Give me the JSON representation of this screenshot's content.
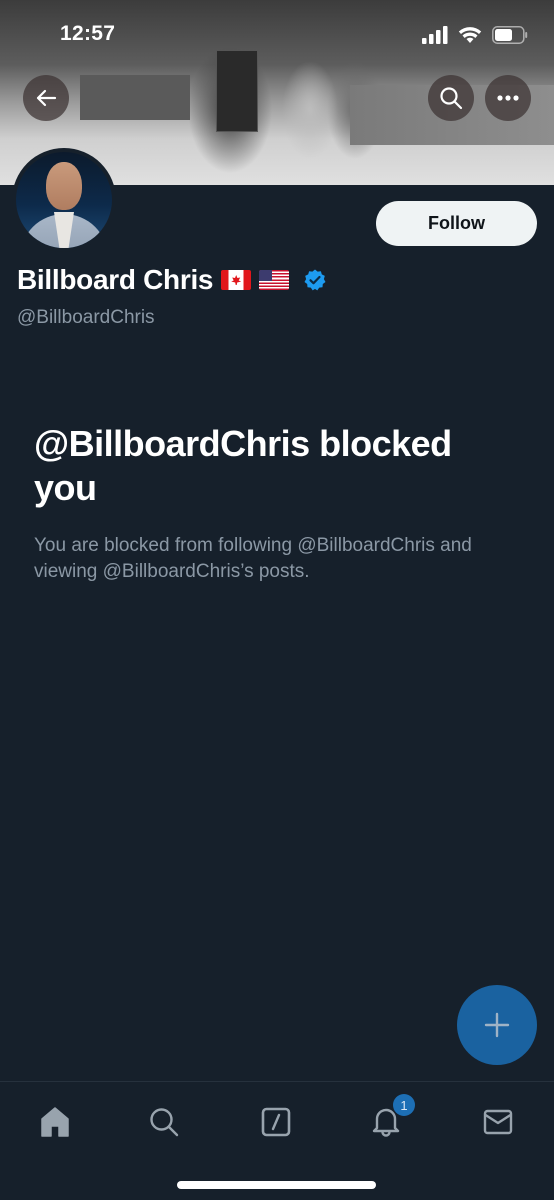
{
  "status_bar": {
    "time": "12:57",
    "icons": [
      "cellular-signal-icon",
      "wifi-icon",
      "battery-icon"
    ]
  },
  "header": {
    "back_icon": "arrow-left-icon",
    "search_icon": "search-icon",
    "more_icon": "more-horizontal-icon"
  },
  "profile": {
    "display_name": "Billboard Chris",
    "flags": [
      "🇨🇦",
      "🇺🇸"
    ],
    "verified": true,
    "handle": "@BillboardChris",
    "follow_label": "Follow"
  },
  "blocked_notice": {
    "title": "@BillboardChris blocked you",
    "description": "You are blocked from following @BillboardChris and viewing @BillboardChris’s posts."
  },
  "fab": {
    "icon": "plus-icon"
  },
  "tab_bar": {
    "items": [
      {
        "name": "home",
        "icon": "home-icon"
      },
      {
        "name": "search",
        "icon": "search-icon"
      },
      {
        "name": "grok",
        "icon": "grok-slash-icon"
      },
      {
        "name": "notifications",
        "icon": "bell-icon",
        "badge": "1"
      },
      {
        "name": "messages",
        "icon": "envelope-icon"
      }
    ]
  },
  "colors": {
    "background": "#16202b",
    "accent": "#1d9bf0",
    "fab": "#1a62a0",
    "secondary_text": "#8b98a5"
  }
}
